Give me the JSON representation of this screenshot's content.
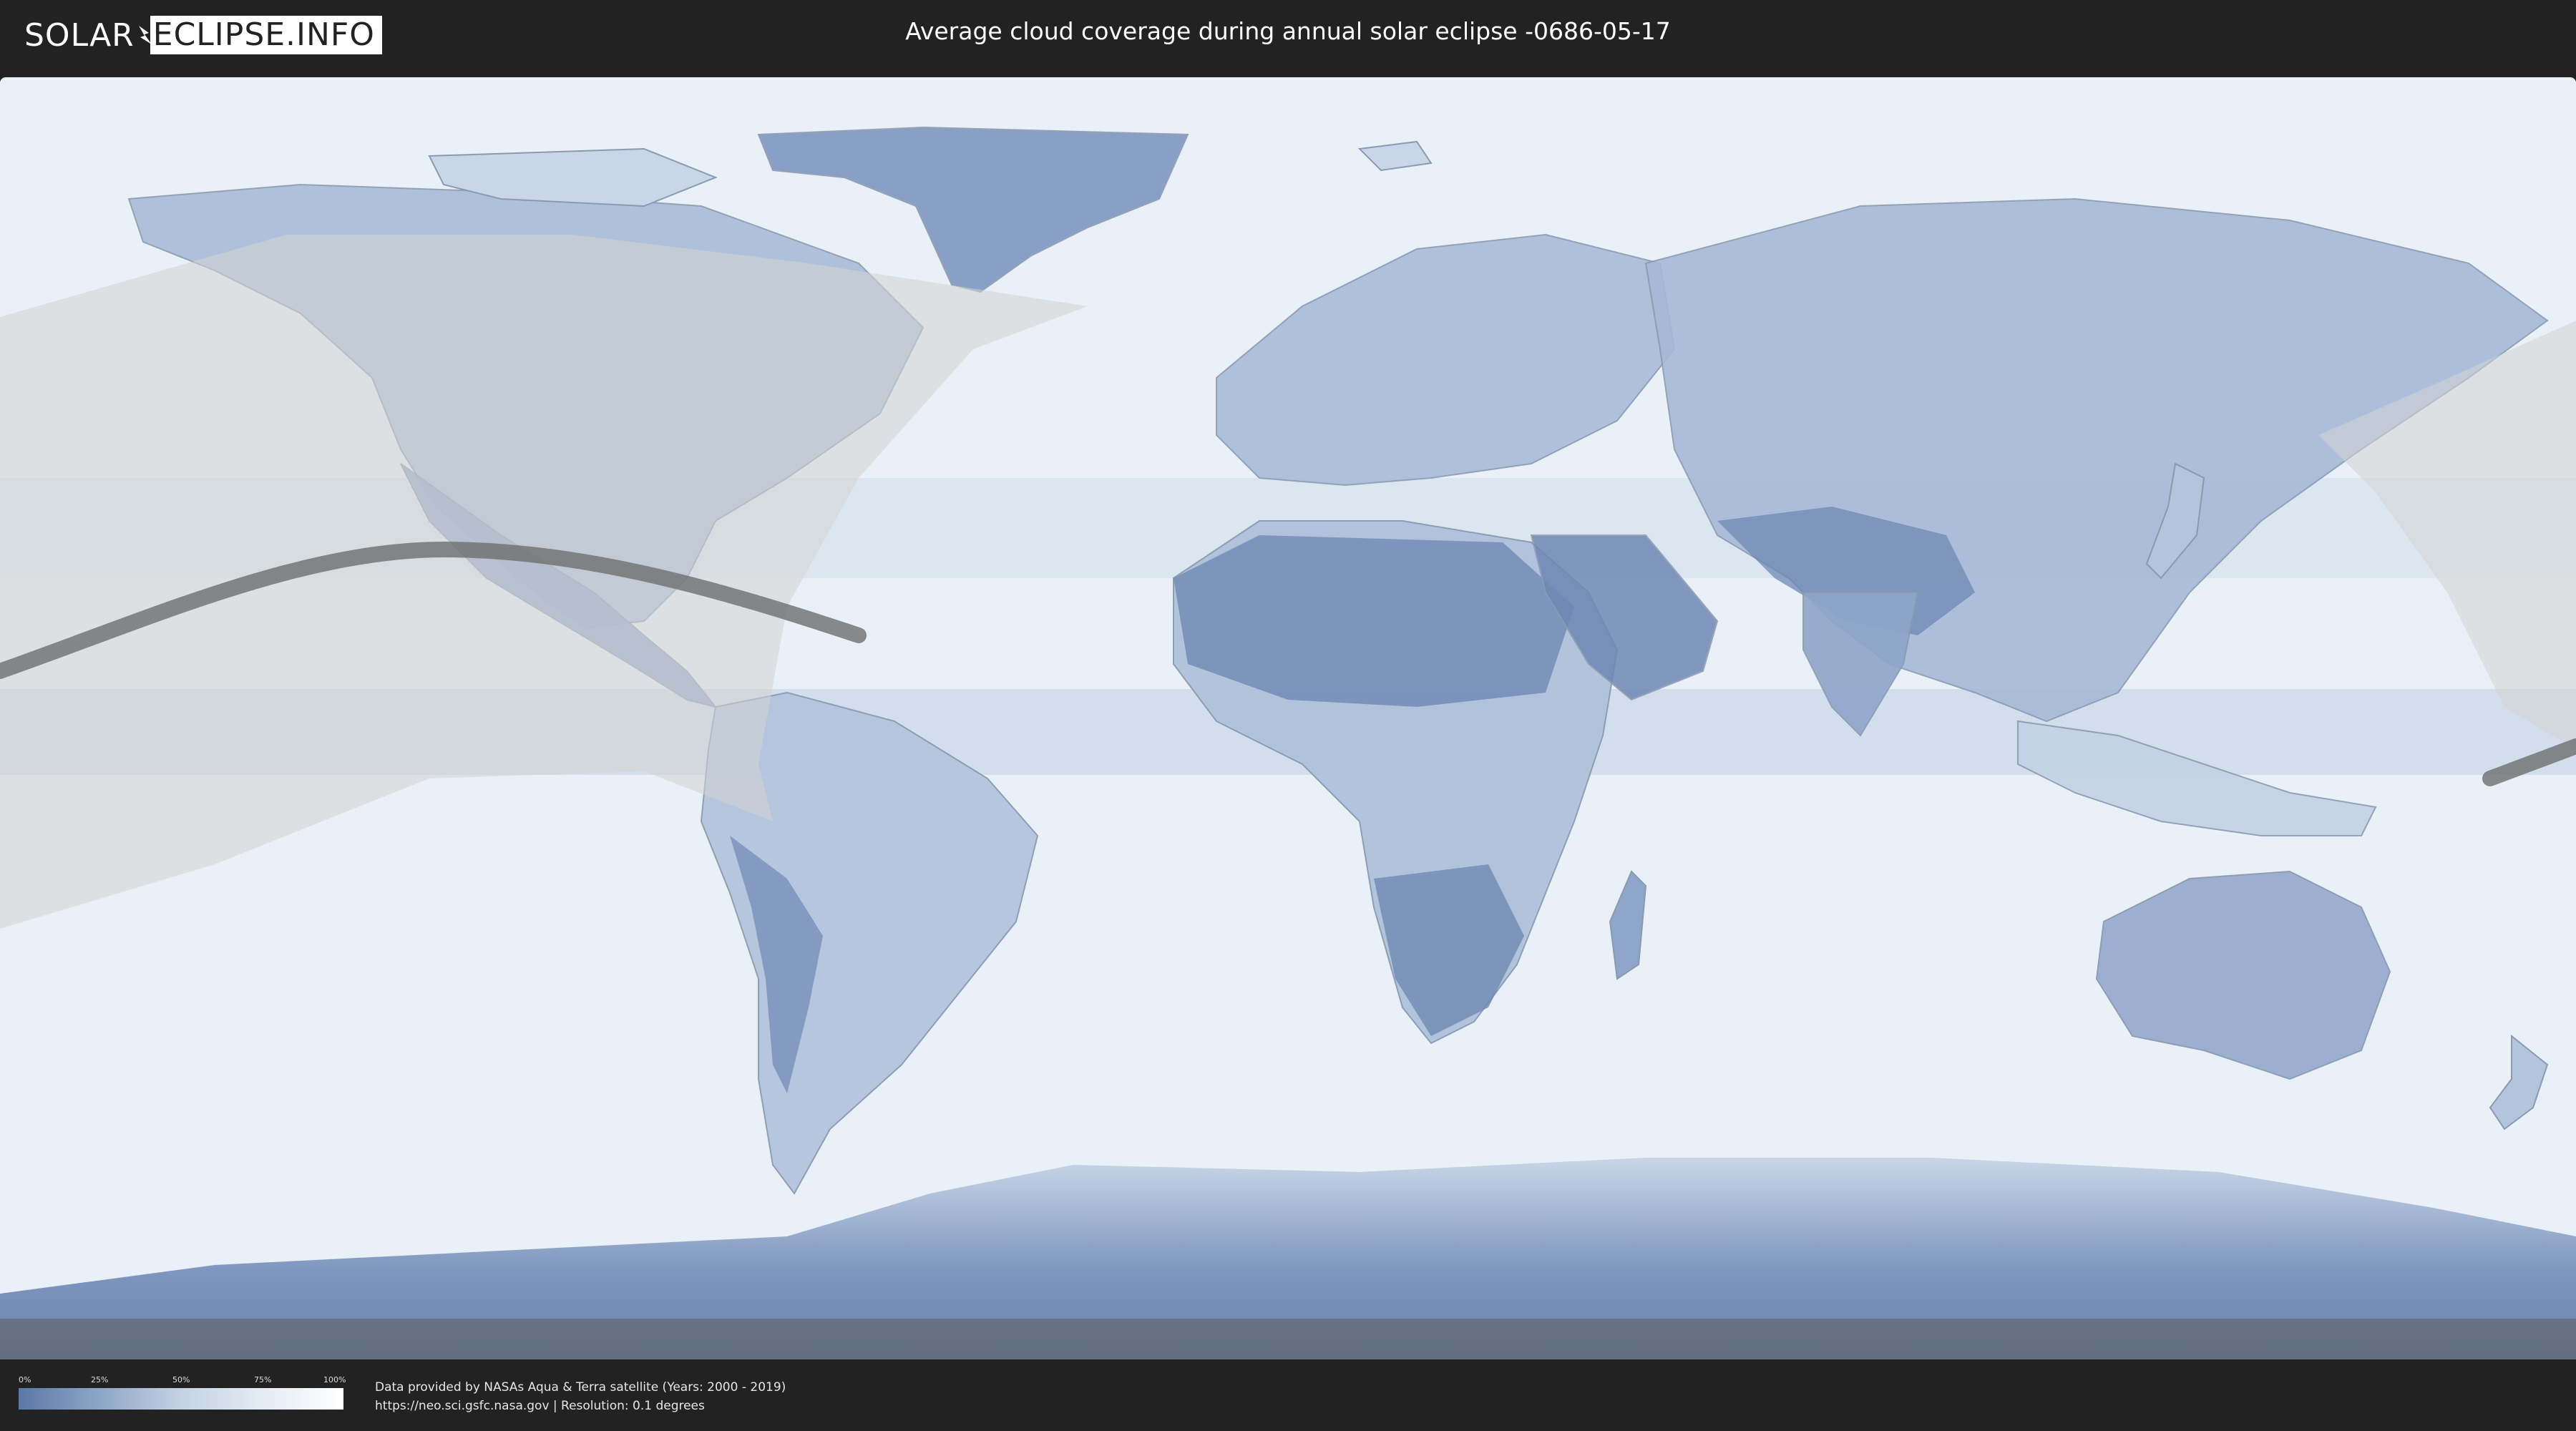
{
  "header": {
    "logo": {
      "solar": "SOLAR",
      "eclipse_info": "ECLIPSE.INFO"
    },
    "title": "Average cloud coverage during annual solar eclipse -0686-05-17"
  },
  "legend": {
    "ticks": [
      "0%",
      "25%",
      "50%",
      "75%",
      "100%"
    ],
    "colors": {
      "low": "#5b78a6",
      "high": "#ffffff"
    }
  },
  "credits": {
    "line1": "Data provided by NASAs Aqua & Terra satellite (Years: 2000 - 2019)",
    "line2": "https://neo.sci.gsfc.nasa.gov | Resolution: 0.1 degrees"
  },
  "map": {
    "ocean_color": "#e8eff7",
    "land_cloud_color": "#9fb3d1",
    "dense_cloud_color": "#6f88b3",
    "penumbra_shade_color": "#d6d6d6",
    "path_color": "#6e6e6e"
  }
}
